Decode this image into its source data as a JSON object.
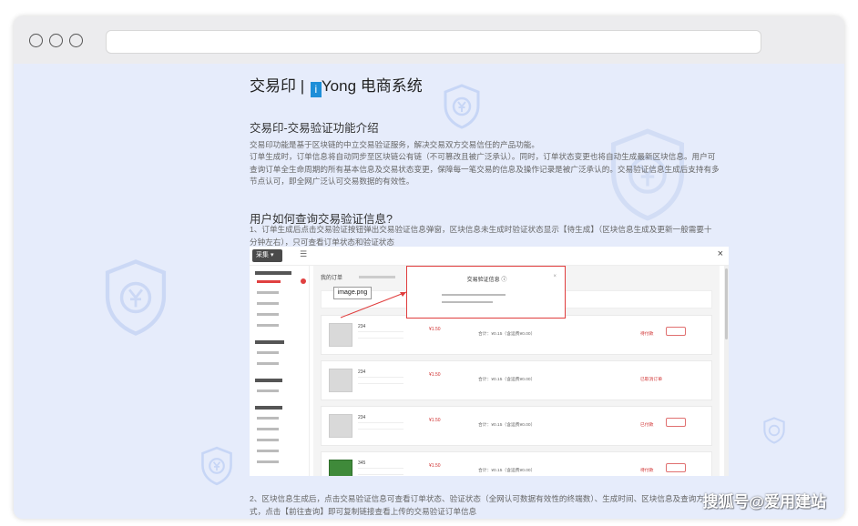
{
  "page": {
    "title_prefix": "交易印 |",
    "title_icon_letter": "i",
    "title_suffix": "Yong 电商系统",
    "section_heading": "交易印-交易验证功能介绍",
    "intro_lines": [
      "交易印功能是基于区块链的中立交易验证服务，解决交易双方交易信任的产品功能。",
      "订单生成时，订单信息将自动同步至区块链公有链（不可篡改且被广泛承认）。同时，订单状态变更也将自动生成最新区块信息。用户可",
      "查询订单全生命周期的所有基本信息及交易状态变更，保障每一笔交易的信息及操作记录是被广泛承认的。交易验证信息生成后支持有多",
      "节点认可，即全网广泛认可交易数据的有效性。"
    ],
    "query_heading": "用户如何查询交易验证信息?",
    "step1_lines": [
      "1、订单生成后点击交易验证按钮弹出交易验证信息弹窗，区块信息未生成时验证状态显示【待生成】（区块信息生成及更新一般需要十",
      "分钟左右），只可查看订单状态和验证状态"
    ],
    "step2_lines": [
      "2、区块信息生成后，点击交易验证信息可查看订单状态、验证状态（全网认可数据有效性的终端数）、生成时间、区块信息及查询方",
      "式，点击【前往查询】即可复制链接查看上传的交易验证订单信息"
    ]
  },
  "screenshot": {
    "collapse_label": "采集",
    "main_title": "我的订单",
    "popup_title": "交易验证信息",
    "popup_close": "×",
    "tooltip": "image.png",
    "close": "×",
    "orders": [
      {
        "name": "234",
        "price": "¥1.50",
        "total": "合计：¥0.15（含运费¥0.00）",
        "status": "待付款"
      },
      {
        "name": "234",
        "price": "¥1.50",
        "total": "合计：¥0.15（含运费¥0.00）",
        "status": "已取消订单"
      },
      {
        "name": "234",
        "price": "¥1.50",
        "total": "合计：¥0.15（含运费¥0.00）",
        "status": "已付款"
      },
      {
        "name": "345",
        "price": "¥1.50",
        "total": "合计：¥0.15（含运费¥0.00）",
        "status": "待付款"
      }
    ]
  },
  "watermark": "搜狐号@爱用建站",
  "colors": {
    "page_bg": "#e6ecfb",
    "accent_red": "#e03c3c",
    "title_icon_blue": "#1d8ed8"
  }
}
